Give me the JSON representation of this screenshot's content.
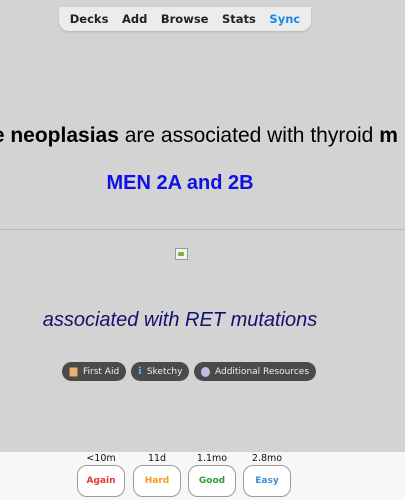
{
  "nav": {
    "items": [
      {
        "label": "Decks"
      },
      {
        "label": "Add"
      },
      {
        "label": "Browse"
      },
      {
        "label": "Stats"
      },
      {
        "label": "Sync"
      }
    ],
    "active": "Sync",
    "active_color": "#1e88e5"
  },
  "card": {
    "front_bold_1": "ne neoplasias",
    "front_text": " are associated with thyroid ",
    "front_bold_2": "m",
    "cloze_answer": "MEN 2A and 2B",
    "cloze_color": "#1010e6",
    "extra_text": "associated with RET mutations",
    "extra_color": "#12126e"
  },
  "resources": [
    {
      "label": "First Aid",
      "icon": "book-icon"
    },
    {
      "label": "Sketchy",
      "icon": "info-icon"
    },
    {
      "label": "Additional Resources",
      "icon": "resources-icon"
    }
  ],
  "answers": [
    {
      "time": "<10m",
      "label": "Again",
      "color": "#e53935"
    },
    {
      "time": "11d",
      "label": "Hard",
      "color": "#f59a1a"
    },
    {
      "time": "1.1mo",
      "label": "Good",
      "color": "#2e9d3a"
    },
    {
      "time": "2.8mo",
      "label": "Easy",
      "color": "#3b8fd6"
    }
  ]
}
